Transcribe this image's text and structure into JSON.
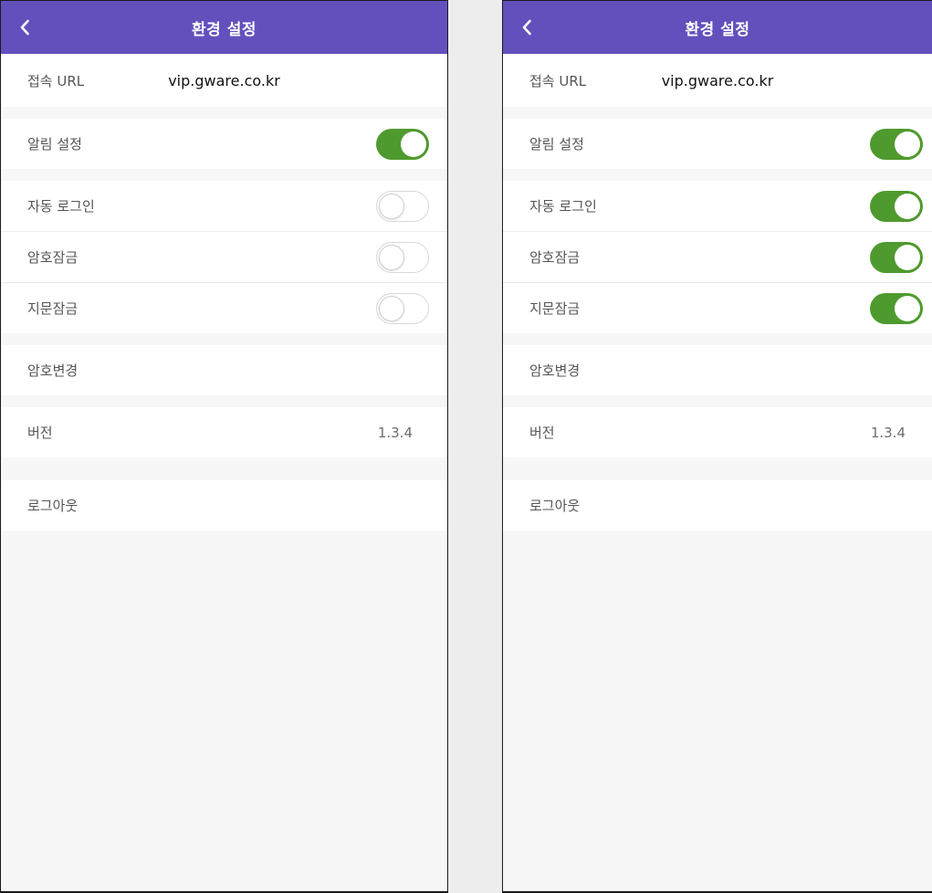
{
  "screens": [
    {
      "header": {
        "title": "환경 설정",
        "back_icon": "chevron-left-icon"
      },
      "url": {
        "label": "접속 URL",
        "value": "vip.gware.co.kr"
      },
      "notification": {
        "label": "알림 설정",
        "on": true
      },
      "security": [
        {
          "label": "자동 로그인",
          "on": false
        },
        {
          "label": "암호잠금",
          "on": false
        },
        {
          "label": "지문잠금",
          "on": false
        }
      ],
      "change_password": {
        "label": "암호변경"
      },
      "version": {
        "label": "버전",
        "value": "1.3.4"
      },
      "logout": {
        "label": "로그아웃"
      }
    },
    {
      "header": {
        "title": "환경 설정",
        "back_icon": "chevron-left-icon"
      },
      "url": {
        "label": "접속 URL",
        "value": "vip.gware.co.kr"
      },
      "notification": {
        "label": "알림 설정",
        "on": true
      },
      "security": [
        {
          "label": "자동 로그인",
          "on": true
        },
        {
          "label": "암호잠금",
          "on": true
        },
        {
          "label": "지문잠금",
          "on": true
        }
      ],
      "change_password": {
        "label": "암호변경"
      },
      "version": {
        "label": "버전",
        "value": "1.3.4"
      },
      "logout": {
        "label": "로그아웃"
      }
    }
  ],
  "colors": {
    "header_bg": "#6350bd",
    "toggle_on": "#4f9a2e",
    "page_bg": "#f7f7f7"
  }
}
